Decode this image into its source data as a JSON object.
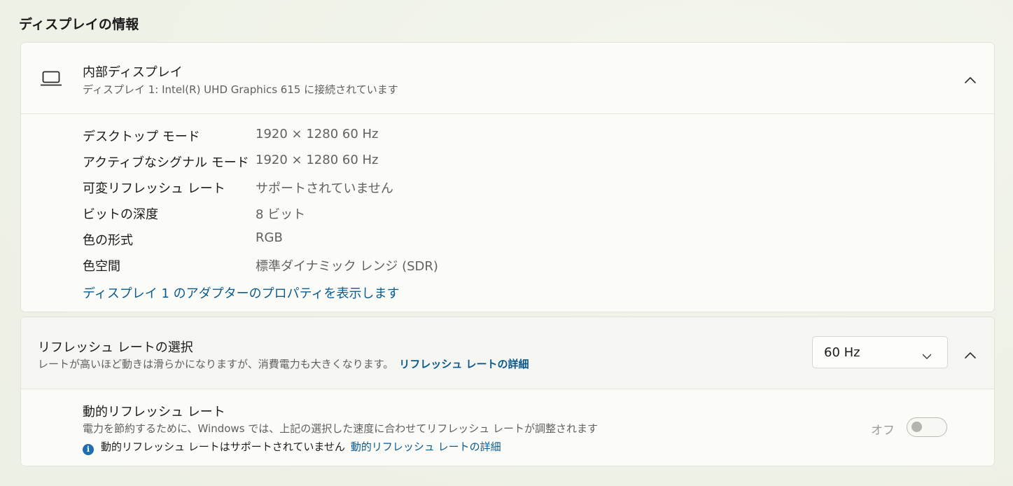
{
  "section_title": "ディスプレイの情報",
  "display_card": {
    "title": "内部ディスプレイ",
    "subtitle": "ディスプレイ 1: Intel(R) UHD Graphics 615 に接続されています",
    "icon": "laptop-icon",
    "expanded": true,
    "rows": [
      {
        "label": "デスクトップ モード",
        "value": "1920 × 1280 60 Hz"
      },
      {
        "label": "アクティブなシグナル モード",
        "value": "1920 × 1280 60 Hz"
      },
      {
        "label": "可変リフレッシュ レート",
        "value": "サポートされていません"
      },
      {
        "label": "ビットの深度",
        "value": "8 ビット"
      },
      {
        "label": "色の形式",
        "value": "RGB"
      },
      {
        "label": "色空間",
        "value": "標準ダイナミック レンジ (SDR)"
      }
    ],
    "adapter_link": "ディスプレイ 1 のアダプターのプロパティを表示します"
  },
  "refresh_card": {
    "title": "リフレッシュ レートの選択",
    "subtitle": "レートが高いほど動きは滑らかになりますが、消費電力も大きくなります。",
    "details_link": "リフレッシュ レートの詳細",
    "dropdown_value": "60 Hz",
    "expanded": true,
    "dynamic": {
      "title": "動的リフレッシュ レート",
      "subtitle": "電力を節約するために、Windows では、上記の選択した速度に合わせてリフレッシュ レートが調整されます",
      "info_text": "動的リフレッシュ レートはサポートされていません",
      "info_link": "動的リフレッシュ レートの詳細",
      "toggle_label": "オフ",
      "toggle_on": false,
      "toggle_enabled": false
    }
  },
  "colors": {
    "accent_link": "#0a5a8e",
    "info_icon": "#1f6fb0"
  }
}
